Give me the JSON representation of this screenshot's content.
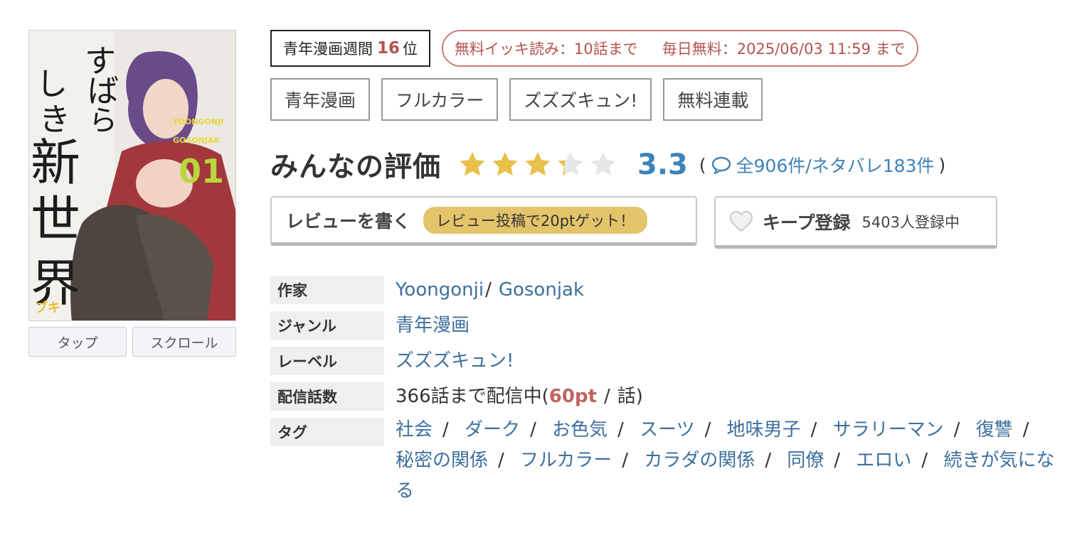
{
  "ranking": {
    "prefix": "青年漫画週間",
    "rank": "16",
    "suffix": "位"
  },
  "free_info": {
    "ikki": "無料イッキ読み：10話まで",
    "daily": "毎日無料：2025/06/03 11:59 まで"
  },
  "genre_tags": [
    "青年漫画",
    "フルカラー",
    "ズズズキュン!",
    "無料連載"
  ],
  "rating": {
    "title": "みんなの評価",
    "score": "3.3",
    "stars_value": 3.3,
    "stars_max": 5,
    "open_paren": "(",
    "counts_text": "全906件/ネタバレ183件",
    "close_paren": ")"
  },
  "actions": {
    "review_label": "レビューを書く",
    "review_bonus": "レビュー投稿で20ptゲット！",
    "keep_label": "キープ登録",
    "keep_count": "5403人登録中"
  },
  "viewer_buttons": [
    "タップ",
    "スクロール"
  ],
  "cover_text": {
    "title_chars": [
      "す",
      "ば",
      "ら",
      "し",
      "き",
      "新",
      "世",
      "界"
    ],
    "author_1": "YOONGONJI",
    "author_2": "GOSONJAK",
    "volume": "01",
    "publisher": "ブキ"
  },
  "info": {
    "author_label": "作家",
    "authors": [
      "Yoongonji",
      "Gosonjak"
    ],
    "author_sep": "/",
    "genre_label": "ジャンル",
    "genre": "青年漫画",
    "publisher_label": "レーベル",
    "publisher": "ズズズキュン!",
    "episodes_label": "配信話数",
    "episodes_text": "366話まで配信中(",
    "episodes_price": "60pt",
    "episodes_sep": "/",
    "episodes_unit": "話)",
    "tags_label": "タグ",
    "tags": [
      "社会",
      "ダーク",
      "お色気",
      "スーツ",
      "地味男子",
      "サラリーマン",
      "復讐",
      "秘密の関係",
      "フルカラー",
      "カラダの関係",
      "同僚",
      "エロい",
      "続きが気になる"
    ],
    "tag_sep": "/"
  },
  "colors": {
    "accent_red": "#b5524e",
    "link_blue": "#3e82b8",
    "star_gold": "#e8c04a",
    "star_empty": "#e6e6e6"
  }
}
